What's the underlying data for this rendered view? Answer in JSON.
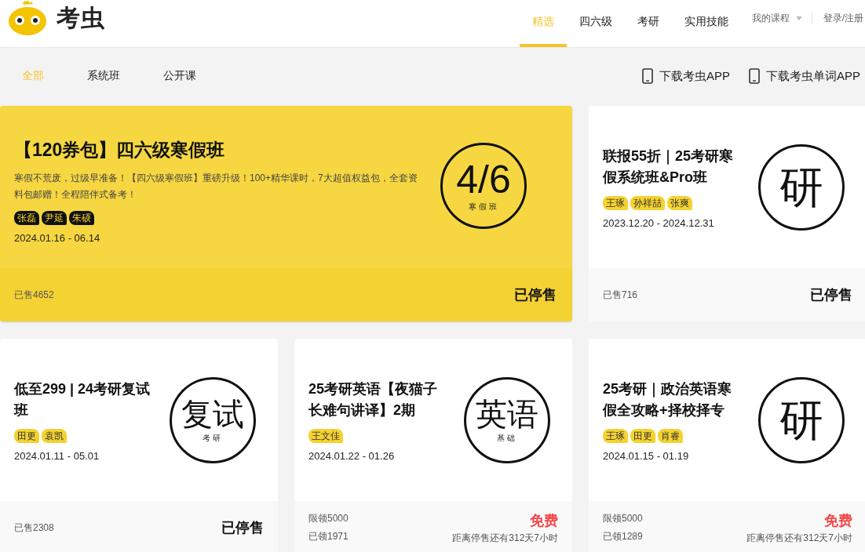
{
  "header": {
    "logo_text": "考虫",
    "nav": [
      {
        "label": "精选",
        "selected": true
      },
      {
        "label": "四六级",
        "selected": false
      },
      {
        "label": "考研",
        "selected": false
      },
      {
        "label": "实用技能",
        "selected": false
      }
    ],
    "my_courses": "我的课程",
    "login": "登录/注册"
  },
  "filters": [
    {
      "label": "全部",
      "selected": true
    },
    {
      "label": "系统班",
      "selected": false
    },
    {
      "label": "公开课",
      "selected": false
    }
  ],
  "downloads": [
    "下载考虫APP",
    "下载考虫单词APP"
  ],
  "courses": [
    {
      "featured": true,
      "title": "【120券包】四六级寒假班",
      "description": "寒假不荒废，过级早准备！【四六级寒假班】重磅升级！100+精华课时，7大超值权益包，全套资料包邮赠！全程陪伴式备考！",
      "tags": [
        "张磊",
        "尹延",
        "朱硕"
      ],
      "dates": "2024.01.16 - 06.14",
      "emblem": {
        "main": "4/6",
        "sub": "寒假班"
      },
      "footer": {
        "kind": "sold",
        "sold": "已售4652",
        "status": "已停售"
      }
    },
    {
      "featured": false,
      "title": "联报55折｜25考研寒假系统班&Pro班",
      "tags": [
        "王琢",
        "孙祥喆",
        "张爽"
      ],
      "dates": "2023.12.20 - 2024.12.31",
      "emblem": {
        "main": "研"
      },
      "footer": {
        "kind": "sold",
        "sold": "已售716",
        "status": "已停售"
      }
    },
    {
      "featured": false,
      "title": "低至299 | 24考研复试班",
      "tags": [
        "田更",
        "袁凯"
      ],
      "dates": "2024.01.11 - 05.01",
      "emblem": {
        "main": "复试",
        "sub": "考研"
      },
      "footer": {
        "kind": "sold",
        "sold": "已售2308",
        "status": "已停售"
      }
    },
    {
      "featured": false,
      "title": "25考研英语【夜猫子长难句讲译】2期",
      "tags": [
        "王文佳"
      ],
      "dates": "2024.01.22 - 01.26",
      "emblem": {
        "main": "英语",
        "sub": "基础"
      },
      "footer": {
        "kind": "free",
        "limit": "限领5000",
        "claimed": "已领1971",
        "price": "免费",
        "countdown": "距离停售还有312天7小时"
      }
    },
    {
      "featured": false,
      "title": "25考研｜政治英语寒假全攻略+择校择专",
      "tags": [
        "王琢",
        "田更",
        "肖睿"
      ],
      "dates": "2024.01.15 - 01.19",
      "emblem": {
        "main": "研"
      },
      "footer": {
        "kind": "free",
        "limit": "限领5000",
        "claimed": "已领1289",
        "price": "免费",
        "countdown": "距离停售还有312天7小时"
      }
    }
  ]
}
